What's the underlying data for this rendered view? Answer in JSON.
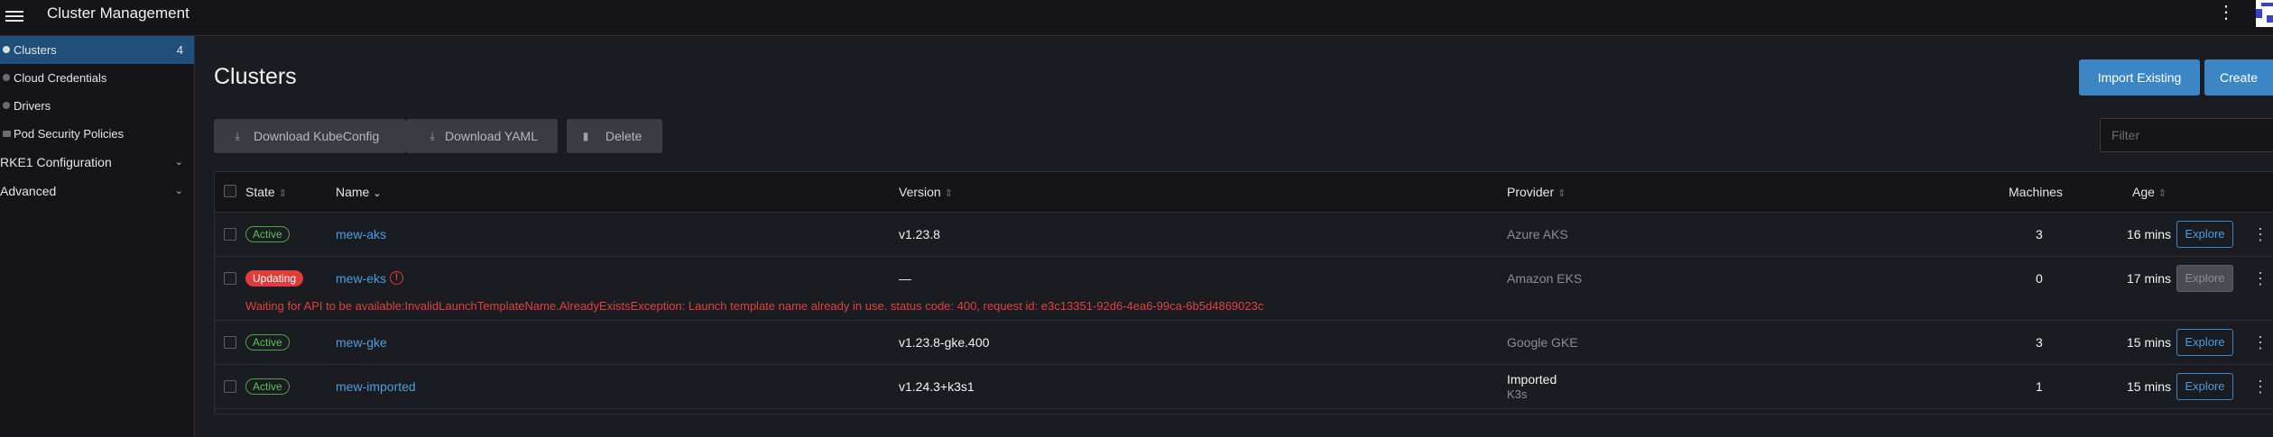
{
  "header": {
    "title": "Cluster Management",
    "menu_icon": "hamburger-icon",
    "more_icon": "kebab-icon"
  },
  "sidebar": {
    "items": [
      {
        "label": "Clusters",
        "count": "4",
        "icon": "cluster-icon"
      },
      {
        "label": "Cloud Credentials",
        "icon": "credential-icon"
      },
      {
        "label": "Drivers",
        "icon": "driver-icon"
      },
      {
        "label": "Pod Security Policies",
        "icon": "folder-icon"
      }
    ],
    "groups": [
      {
        "label": "RKE1 Configuration",
        "icon": "chevron-down-icon"
      },
      {
        "label": "Advanced",
        "icon": "chevron-down-icon"
      }
    ]
  },
  "page": {
    "title": "Clusters",
    "import_label": "Import Existing",
    "create_label": "Create",
    "download_kubeconfig_label": "Download KubeConfig",
    "download_yaml_label": "Download YAML",
    "delete_label": "Delete",
    "filter_placeholder": "Filter"
  },
  "table": {
    "columns": [
      "State",
      "Name",
      "Version",
      "Provider",
      "Machines",
      "Age"
    ],
    "sorted_column": "Name",
    "rows": [
      {
        "state": "Active",
        "name": "mew-aks",
        "version": "v1.23.8",
        "provider": "Azure AKS",
        "machines": "3",
        "age": "16 mins",
        "action": "Explore"
      },
      {
        "state": "Updating",
        "name": "mew-eks",
        "version": "—",
        "provider": "Amazon EKS",
        "machines": "0",
        "age": "17 mins",
        "action": "Explore",
        "error": "Waiting for API to be available:InvalidLaunchTemplateName.AlreadyExistsException: Launch template name already in use. status code: 400, request id: e3c13351-92d6-4ea6-99ca-6b5d4869023c"
      },
      {
        "state": "Active",
        "name": "mew-gke",
        "version": "v1.23.8-gke.400",
        "provider": "Google GKE",
        "machines": "3",
        "age": "15 mins",
        "action": "Explore"
      },
      {
        "state": "Active",
        "name": "mew-imported",
        "version": "v1.24.3+k3s1",
        "provider": "Imported",
        "provider_sub": "K3s",
        "machines": "1",
        "age": "15 mins",
        "action": "Explore"
      }
    ]
  },
  "colors": {
    "accent": "#3d86c6",
    "link": "#4a9de0",
    "active": "#5fbf5a",
    "error": "#e03c3c",
    "background": "#1b1c21",
    "nav_active": "#1f4f7a"
  }
}
